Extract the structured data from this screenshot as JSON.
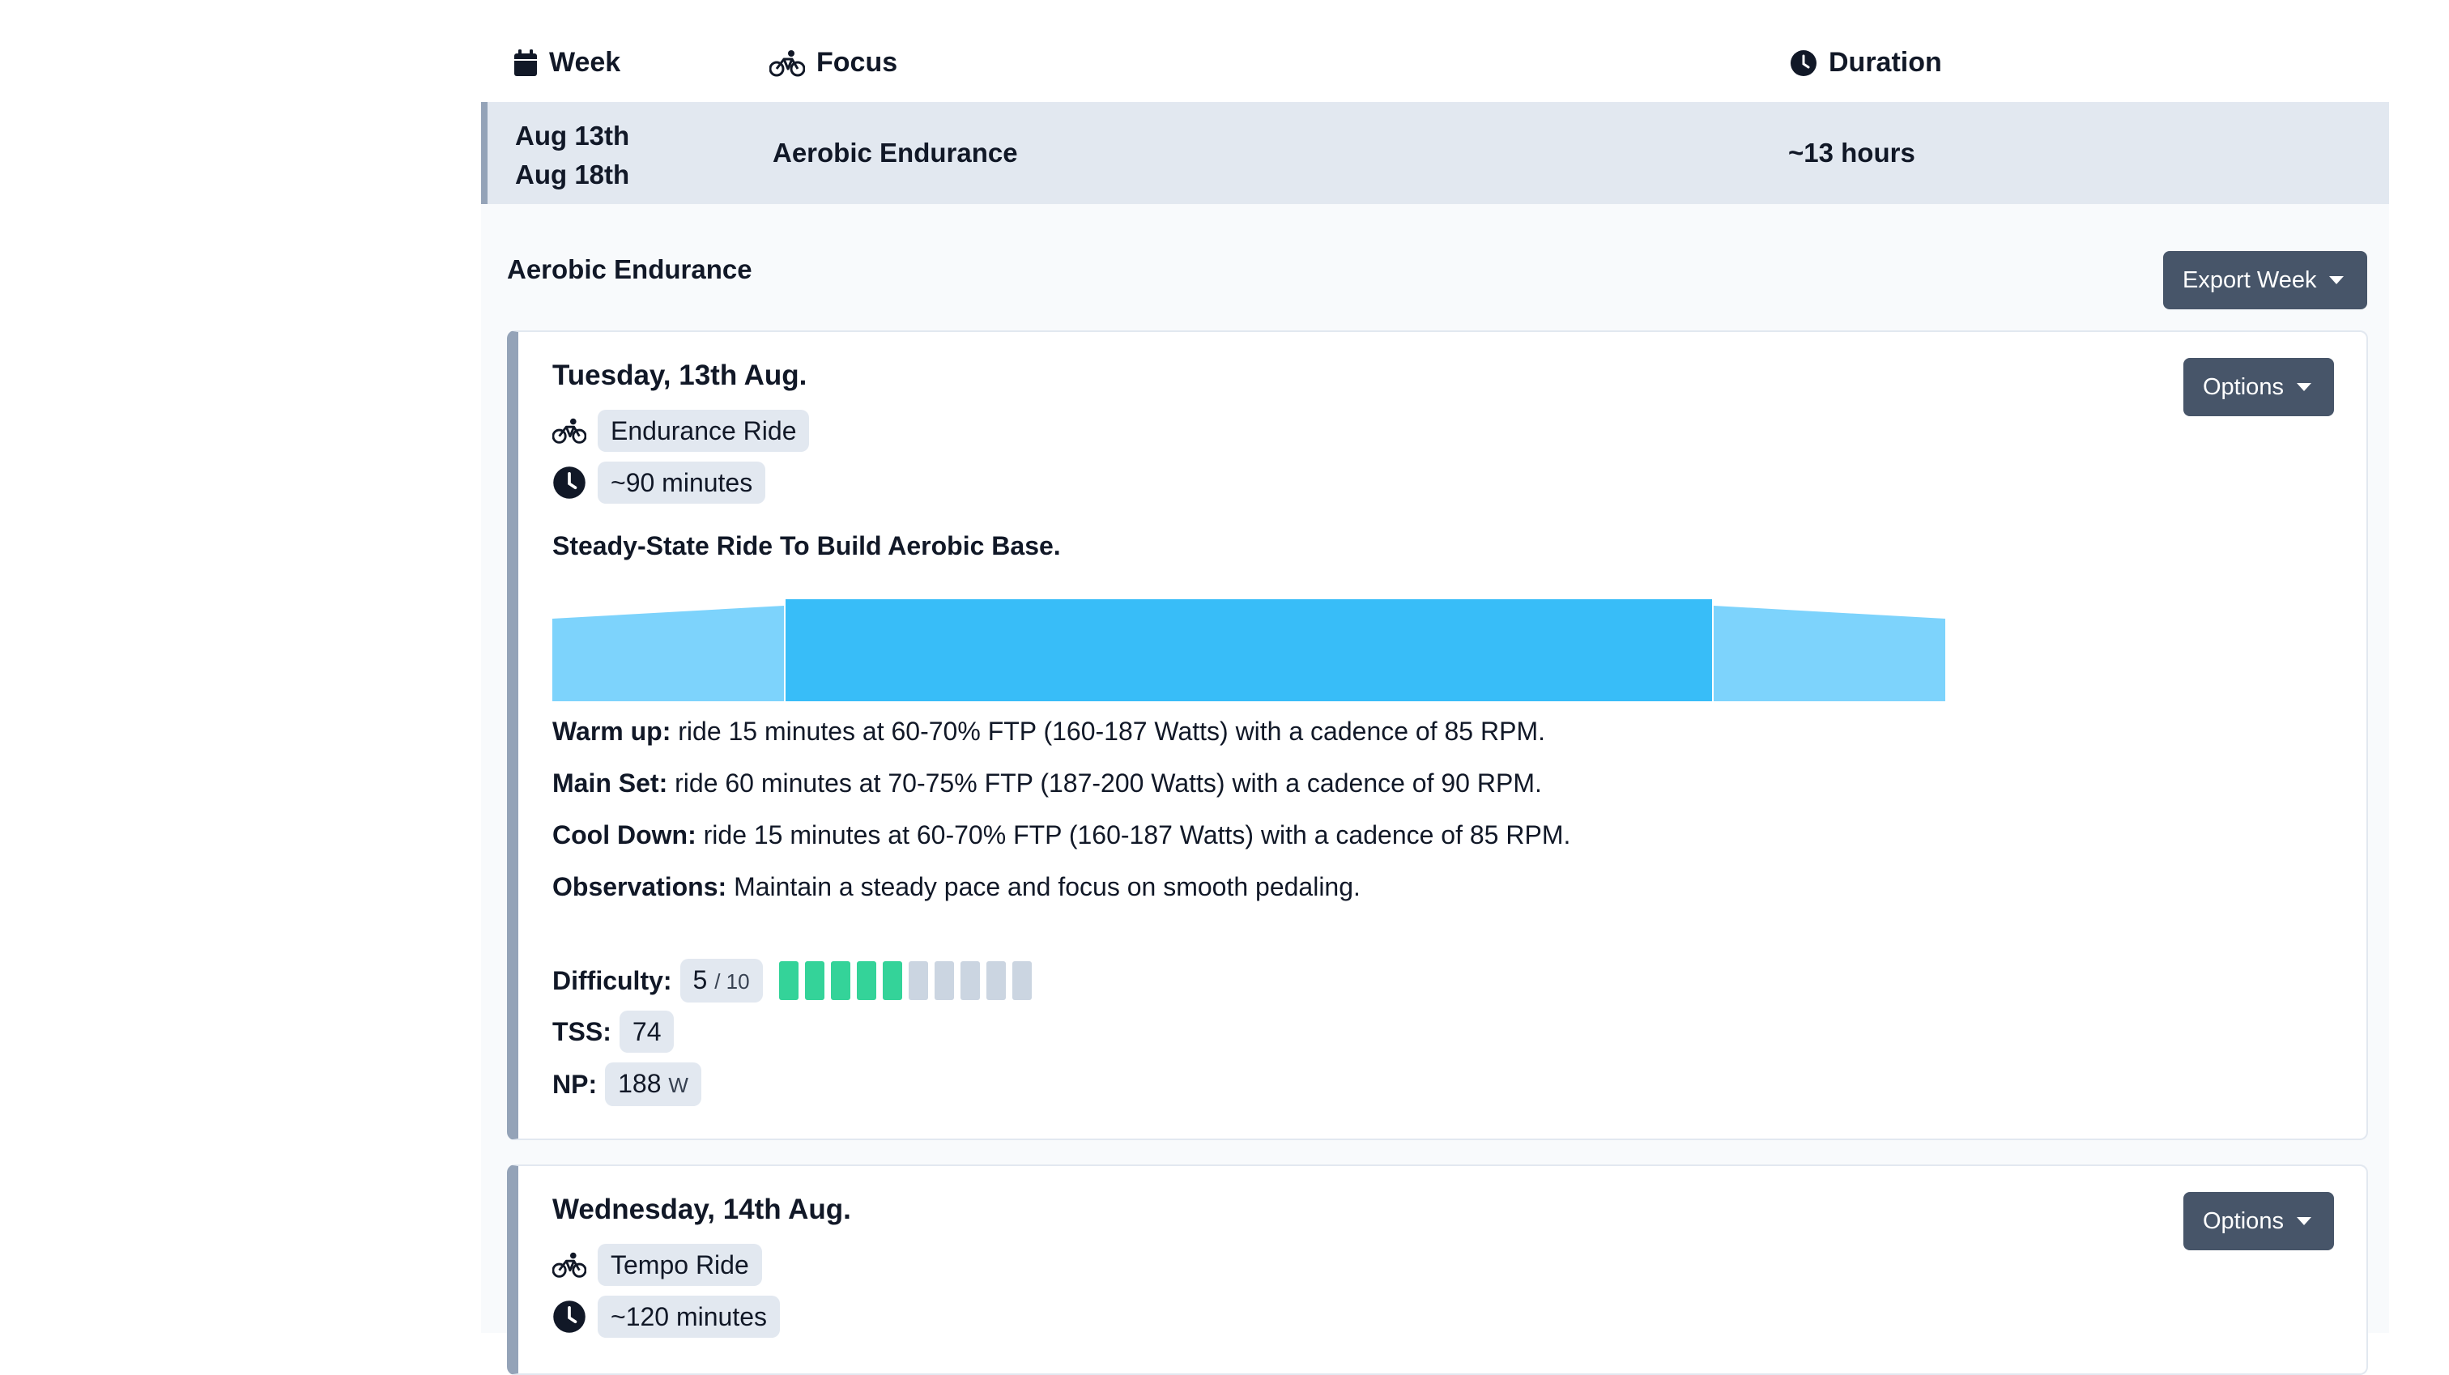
{
  "table": {
    "headers": {
      "week": "Week",
      "focus": "Focus",
      "duration": "Duration"
    },
    "active_row": {
      "start": "Aug 13th",
      "end": "Aug 18th",
      "focus": "Aerobic Endurance",
      "duration": "~13 hours"
    }
  },
  "panel": {
    "title": "Aerobic Endurance",
    "export_label": "Export Week",
    "workouts": [
      {
        "date": "Tuesday, 13th Aug.",
        "type": "Endurance Ride",
        "duration": "~90 minutes",
        "summary": "Steady-State Ride To Build Aerobic Base.",
        "options_label": "Options",
        "steps": [
          {
            "label": "Warm up:",
            "text": " ride 15 minutes at 60-70% FTP (160-187 Watts) with a cadence of 85 RPM."
          },
          {
            "label": "Main Set:",
            "text": " ride 60 minutes at 70-75% FTP (187-200 Watts) with a cadence of 90 RPM."
          },
          {
            "label": "Cool Down:",
            "text": " ride 15 minutes at 60-70% FTP (160-187 Watts) with a cadence of 85 RPM."
          },
          {
            "label": "Observations:",
            "text": " Maintain a steady pace and focus on smooth pedaling."
          }
        ],
        "difficulty_label": "Difficulty:",
        "difficulty_value": "5",
        "difficulty_max": "/ 10",
        "difficulty_level": 5,
        "difficulty_scale": 10,
        "tss_label": "TSS:",
        "tss_value": "74",
        "np_label": "NP:",
        "np_value": "188",
        "np_unit": "W"
      },
      {
        "date": "Wednesday, 14th Aug.",
        "type": "Tempo Ride",
        "duration": "~120 minutes",
        "options_label": "Options"
      }
    ]
  },
  "colors": {
    "accent": "#475569",
    "row_highlight": "#e2e8f0",
    "profile_light": "#7dd3fc",
    "profile_main": "#38bdf8",
    "difficulty_on": "#34d399",
    "difficulty_off": "#cbd5e1"
  },
  "icons": {
    "week": "calendar-icon",
    "focus": "bicycle-icon",
    "duration": "clock-icon"
  }
}
